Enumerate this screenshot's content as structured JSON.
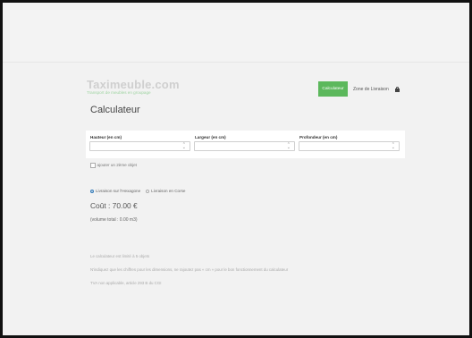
{
  "brand": {
    "title": "Taximeuble.com",
    "subtitle": "Transport de meubles en groupage"
  },
  "nav": {
    "active_label": "Calculateur",
    "zone_label": "Zone de Livraison",
    "lock_icon": "lock-icon"
  },
  "page": {
    "title": "Calculateur"
  },
  "form": {
    "fields": [
      {
        "label": "Hauteur (en cm)",
        "value": ""
      },
      {
        "label": "Largeur (en cm)",
        "value": ""
      },
      {
        "label": "Profondeur (en cm)",
        "value": ""
      }
    ],
    "add_object_label": "ajouter un 2ème objet"
  },
  "delivery": {
    "options": [
      {
        "label": "Livraison sur l'Hexagone",
        "selected": true
      },
      {
        "label": "Livraison en Corse",
        "selected": false
      }
    ]
  },
  "result": {
    "cost": "Coût : 70.00 €",
    "volume": "(volume total : 0.00 m3)"
  },
  "notes": [
    "Le calculateur est limité à 5 objets",
    "N'indiquez que les chiffres pour les dimensions, ne rajoutez pas « cm » pour le bon fonctionnement du calculateur",
    "TVA non applicable, article 293 B du CGI"
  ],
  "colors": {
    "accent_green": "#5cb85c",
    "radio_blue": "#337ab7"
  }
}
